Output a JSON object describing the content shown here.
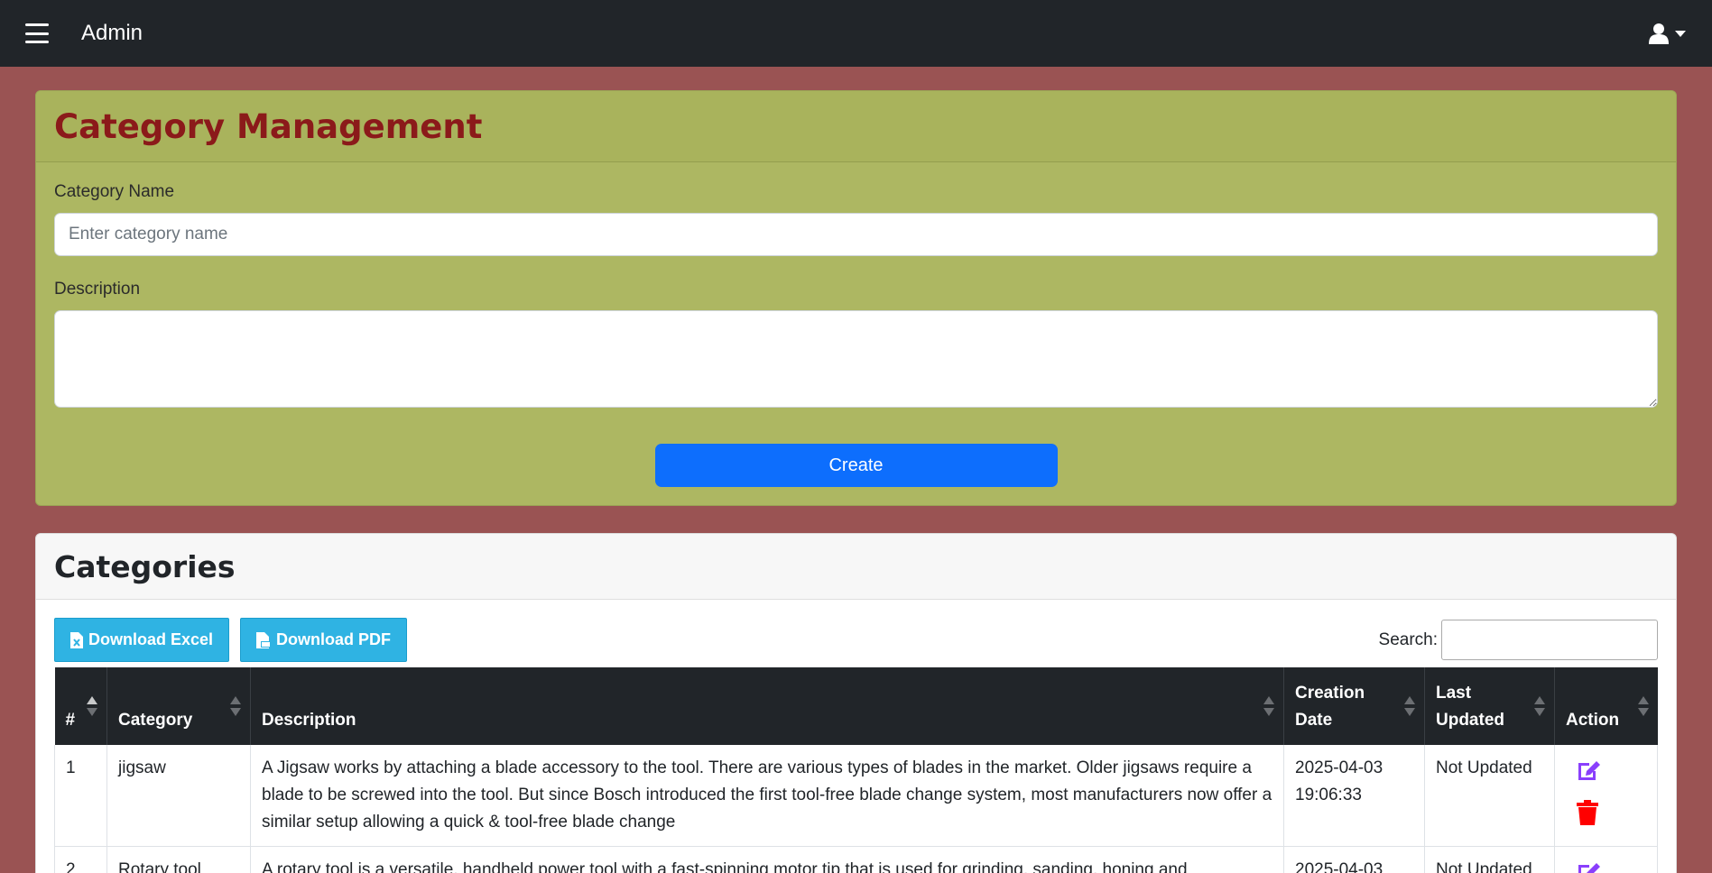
{
  "topbar": {
    "brand": "Admin",
    "menu_icon": "hamburger-icon",
    "user_icon": "user-icon"
  },
  "form_card": {
    "title": "Category Management",
    "name_label": "Category Name",
    "name_placeholder": "Enter category name",
    "name_value": "",
    "description_label": "Description",
    "description_value": "",
    "create_label": "Create"
  },
  "list_card": {
    "title": "Categories",
    "download_excel": "Download Excel",
    "download_pdf": "Download PDF",
    "search_label": "Search:",
    "search_value": "",
    "columns": [
      "#",
      "Category",
      "Description",
      "Creation Date",
      "Last Updated",
      "Action"
    ],
    "rows": [
      {
        "num": "1",
        "category": "jigsaw",
        "description": "A Jigsaw works by attaching a blade accessory to the tool. There are various types of blades in the market. Older jigsaws require a blade to be screwed into the tool. But since Bosch introduced the first tool-free blade change system, most manufacturers now offer a similar setup allowing a quick & tool-free blade change",
        "created": "2025-04-03 19:06:33",
        "updated": "Not Updated"
      },
      {
        "num": "2",
        "category": "Rotary tool",
        "description": "A rotary tool is a versatile, handheld power tool with a fast-spinning motor tip that is used for grinding, sanding, honing and",
        "created": "2025-04-03",
        "updated": "Not Updated"
      }
    ]
  },
  "colors": {
    "page_bg": "#9a5353",
    "form_card_bg": "#adb762",
    "title_red": "#8b1a1a",
    "primary": "#0d6efd",
    "info": "#2fb3e3",
    "edit_purple": "#8a3ffc",
    "delete_red": "#ff0000"
  }
}
